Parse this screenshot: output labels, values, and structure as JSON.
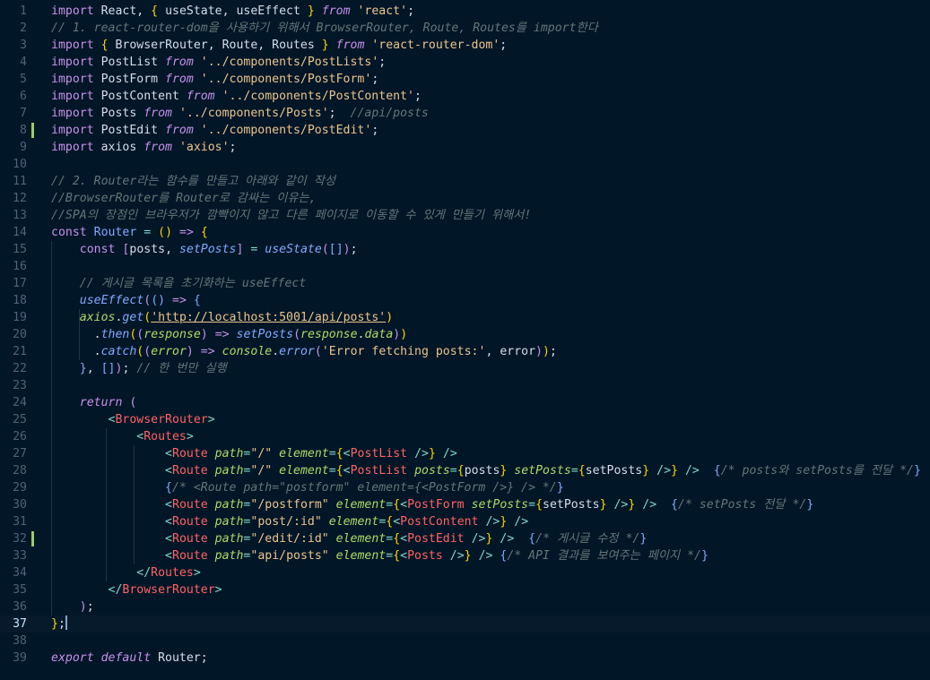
{
  "editor": {
    "language": "javascript-react",
    "theme_colors": {
      "background": "#011627",
      "keyword": "#c792ea",
      "function": "#82aaff",
      "string": "#ecc48d",
      "comment": "#637777",
      "variable": "#addb67",
      "tag": "#ff6363",
      "operator": "#7fdbca",
      "text": "#d6deeb",
      "modified_marker": "#9ccc65"
    },
    "current_line": 37,
    "modified_lines": [
      8,
      32
    ],
    "lines": [
      [
        [
          "kw2",
          "import"
        ],
        [
          "id",
          " React, "
        ],
        [
          "cb",
          "{"
        ],
        [
          "id",
          " useState, useEffect "
        ],
        [
          "cb",
          "}"
        ],
        [
          "id",
          " "
        ],
        [
          "kw",
          "from"
        ],
        [
          "id",
          " "
        ],
        [
          "str",
          "'react'"
        ],
        [
          "id",
          ";"
        ]
      ],
      [
        [
          "cm",
          "// 1. react-router-dom을 사용하기 위해서 BrowserRouter, Route, Routes를 import한다"
        ]
      ],
      [
        [
          "kw2",
          "import"
        ],
        [
          "id",
          " "
        ],
        [
          "cb",
          "{"
        ],
        [
          "id",
          " BrowserRouter, Route, Routes "
        ],
        [
          "cb",
          "}"
        ],
        [
          "id",
          " "
        ],
        [
          "kw",
          "from"
        ],
        [
          "id",
          " "
        ],
        [
          "str",
          "'react-router-dom'"
        ],
        [
          "id",
          ";"
        ]
      ],
      [
        [
          "kw2",
          "import"
        ],
        [
          "id",
          " PostList "
        ],
        [
          "kw",
          "from"
        ],
        [
          "id",
          " "
        ],
        [
          "str",
          "'../components/PostLists'"
        ],
        [
          "id",
          ";"
        ]
      ],
      [
        [
          "kw2",
          "import"
        ],
        [
          "id",
          " PostForm "
        ],
        [
          "kw",
          "from"
        ],
        [
          "id",
          " "
        ],
        [
          "str",
          "'../components/PostForm'"
        ],
        [
          "id",
          ";"
        ]
      ],
      [
        [
          "kw2",
          "import"
        ],
        [
          "id",
          " PostContent "
        ],
        [
          "kw",
          "from"
        ],
        [
          "id",
          " "
        ],
        [
          "str",
          "'../components/PostContent'"
        ],
        [
          "id",
          ";"
        ]
      ],
      [
        [
          "kw2",
          "import"
        ],
        [
          "id",
          " Posts "
        ],
        [
          "kw",
          "from"
        ],
        [
          "id",
          " "
        ],
        [
          "str",
          "'../components/Posts'"
        ],
        [
          "id",
          ";  "
        ],
        [
          "cm",
          "//api/posts"
        ]
      ],
      [
        [
          "kw2",
          "import"
        ],
        [
          "id",
          " PostEdit "
        ],
        [
          "kw",
          "from"
        ],
        [
          "id",
          " "
        ],
        [
          "str",
          "'../components/PostEdit'"
        ],
        [
          "id",
          ";"
        ]
      ],
      [
        [
          "kw2",
          "import"
        ],
        [
          "id",
          " axios "
        ],
        [
          "kw",
          "from"
        ],
        [
          "id",
          " "
        ],
        [
          "str",
          "'axios'"
        ],
        [
          "id",
          ";"
        ]
      ],
      [],
      [
        [
          "cm",
          "// 2. Router라는 함수를 만들고 아래와 같이 작성"
        ]
      ],
      [
        [
          "cm",
          "//BrowserRouter를 Router로 감싸는 이유는,"
        ]
      ],
      [
        [
          "cm",
          "//SPA의 장점인 브라우저가 깜빡이지 않고 다른 페이지로 이동할 수 있게 만들기 위해서!"
        ]
      ],
      [
        [
          "kw2",
          "const"
        ],
        [
          "id",
          " "
        ],
        [
          "fn2",
          "Router"
        ],
        [
          "id",
          " "
        ],
        [
          "punc",
          "="
        ],
        [
          "id",
          " "
        ],
        [
          "cb",
          "()"
        ],
        [
          "id",
          " "
        ],
        [
          "kw2",
          "=>"
        ],
        [
          "id",
          " "
        ],
        [
          "cb",
          "{"
        ]
      ],
      [
        [
          "id",
          "    "
        ],
        [
          "kw2",
          "const"
        ],
        [
          "id",
          " "
        ],
        [
          "kw2",
          "["
        ],
        [
          "id",
          "posts, "
        ],
        [
          "fn",
          "setPosts"
        ],
        [
          "kw2",
          "]"
        ],
        [
          "id",
          " "
        ],
        [
          "punc",
          "="
        ],
        [
          "id",
          " "
        ],
        [
          "fn",
          "useState"
        ],
        [
          "kw2",
          "("
        ],
        [
          "fn2",
          "[]"
        ],
        [
          "kw2",
          ")"
        ],
        [
          "id",
          ";"
        ]
      ],
      [],
      [
        [
          "id",
          "    "
        ],
        [
          "cm",
          "// 게시글 목록을 초기화하는 useEffect"
        ]
      ],
      [
        [
          "id",
          "    "
        ],
        [
          "fn",
          "useEffect"
        ],
        [
          "kw2",
          "("
        ],
        [
          "fn2",
          "()"
        ],
        [
          "id",
          " "
        ],
        [
          "kw2",
          "=>"
        ],
        [
          "id",
          " "
        ],
        [
          "fn2",
          "{"
        ]
      ],
      [
        [
          "id",
          "    "
        ],
        [
          "var",
          "axios"
        ],
        [
          "id",
          "."
        ],
        [
          "fn",
          "get"
        ],
        [
          "cb",
          "("
        ],
        [
          "url",
          "'http://localhost:5001/api/posts'"
        ],
        [
          "cb",
          ")"
        ]
      ],
      [
        [
          "id",
          "      ."
        ],
        [
          "fn",
          "then"
        ],
        [
          "cb",
          "("
        ],
        [
          "kw2",
          "("
        ],
        [
          "var",
          "response"
        ],
        [
          "kw2",
          ")"
        ],
        [
          "id",
          " "
        ],
        [
          "kw2",
          "=>"
        ],
        [
          "id",
          " "
        ],
        [
          "fn",
          "setPosts"
        ],
        [
          "kw2",
          "("
        ],
        [
          "var",
          "response"
        ],
        [
          "id",
          "."
        ],
        [
          "var",
          "data"
        ],
        [
          "kw2",
          ")"
        ],
        [
          "cb",
          ")"
        ]
      ],
      [
        [
          "id",
          "      ."
        ],
        [
          "fn",
          "catch"
        ],
        [
          "cb",
          "("
        ],
        [
          "kw2",
          "("
        ],
        [
          "var",
          "error"
        ],
        [
          "kw2",
          ")"
        ],
        [
          "id",
          " "
        ],
        [
          "kw2",
          "=>"
        ],
        [
          "id",
          " "
        ],
        [
          "var",
          "console"
        ],
        [
          "id",
          "."
        ],
        [
          "fn",
          "error"
        ],
        [
          "kw2",
          "("
        ],
        [
          "str",
          "'Error fetching posts:'"
        ],
        [
          "id",
          ", error"
        ],
        [
          "kw2",
          ")"
        ],
        [
          "cb",
          ")"
        ],
        [
          "id",
          ";"
        ]
      ],
      [
        [
          "id",
          "    "
        ],
        [
          "fn2",
          "}"
        ],
        [
          "id",
          ", "
        ],
        [
          "fn2",
          "[]"
        ],
        [
          "kw2",
          ")"
        ],
        [
          "id",
          "; "
        ],
        [
          "cm",
          "// 한 번만 실행"
        ]
      ],
      [],
      [
        [
          "id",
          "    "
        ],
        [
          "kw",
          "return"
        ],
        [
          "id",
          " "
        ],
        [
          "kw2",
          "("
        ]
      ],
      [
        [
          "id",
          "        "
        ],
        [
          "punc",
          "<"
        ],
        [
          "tg",
          "BrowserRouter"
        ],
        [
          "punc",
          ">"
        ]
      ],
      [
        [
          "id",
          "            "
        ],
        [
          "punc",
          "<"
        ],
        [
          "tg",
          "Routes"
        ],
        [
          "punc",
          ">"
        ]
      ],
      [
        [
          "id",
          "                "
        ],
        [
          "punc",
          "<"
        ],
        [
          "tg",
          "Route"
        ],
        [
          "id",
          " "
        ],
        [
          "var",
          "path"
        ],
        [
          "punc",
          "="
        ],
        [
          "str",
          "\"/\""
        ],
        [
          "id",
          " "
        ],
        [
          "var",
          "element"
        ],
        [
          "punc",
          "="
        ],
        [
          "cb",
          "{"
        ],
        [
          "punc",
          "<"
        ],
        [
          "tg",
          "PostList"
        ],
        [
          "id",
          " "
        ],
        [
          "punc",
          "/>"
        ],
        [
          "cb",
          "}"
        ],
        [
          "id",
          " "
        ],
        [
          "punc",
          "/>"
        ]
      ],
      [
        [
          "id",
          "                "
        ],
        [
          "punc",
          "<"
        ],
        [
          "tg",
          "Route"
        ],
        [
          "id",
          " "
        ],
        [
          "var",
          "path"
        ],
        [
          "punc",
          "="
        ],
        [
          "str",
          "\"/\""
        ],
        [
          "id",
          " "
        ],
        [
          "var",
          "element"
        ],
        [
          "punc",
          "="
        ],
        [
          "cb",
          "{"
        ],
        [
          "punc",
          "<"
        ],
        [
          "tg",
          "PostList"
        ],
        [
          "id",
          " "
        ],
        [
          "var",
          "posts"
        ],
        [
          "punc",
          "="
        ],
        [
          "cb",
          "{"
        ],
        [
          "id",
          "posts"
        ],
        [
          "cb",
          "}"
        ],
        [
          "id",
          " "
        ],
        [
          "var",
          "setPosts"
        ],
        [
          "punc",
          "="
        ],
        [
          "cb",
          "{"
        ],
        [
          "id",
          "setPosts"
        ],
        [
          "cb",
          "}"
        ],
        [
          "id",
          " "
        ],
        [
          "punc",
          "/>"
        ],
        [
          "cb",
          "}"
        ],
        [
          "id",
          " "
        ],
        [
          "punc",
          "/>"
        ],
        [
          "id",
          "  "
        ],
        [
          "fn2",
          "{"
        ],
        [
          "cm",
          "/* posts와 setPosts를 전달 */"
        ],
        [
          "fn2",
          "}"
        ]
      ],
      [
        [
          "id",
          "                "
        ],
        [
          "fn2",
          "{"
        ],
        [
          "cm",
          "/* <Route path=\"postform\" element={<PostForm />} /> */"
        ],
        [
          "fn2",
          "}"
        ]
      ],
      [
        [
          "id",
          "                "
        ],
        [
          "punc",
          "<"
        ],
        [
          "tg",
          "Route"
        ],
        [
          "id",
          " "
        ],
        [
          "var",
          "path"
        ],
        [
          "punc",
          "="
        ],
        [
          "str",
          "\"/postform\""
        ],
        [
          "id",
          " "
        ],
        [
          "var",
          "element"
        ],
        [
          "punc",
          "="
        ],
        [
          "cb",
          "{"
        ],
        [
          "punc",
          "<"
        ],
        [
          "tg",
          "PostForm"
        ],
        [
          "id",
          " "
        ],
        [
          "var",
          "setPosts"
        ],
        [
          "punc",
          "="
        ],
        [
          "cb",
          "{"
        ],
        [
          "id",
          "setPosts"
        ],
        [
          "cb",
          "}"
        ],
        [
          "id",
          " "
        ],
        [
          "punc",
          "/>"
        ],
        [
          "cb",
          "}"
        ],
        [
          "id",
          " "
        ],
        [
          "punc",
          "/>"
        ],
        [
          "id",
          "  "
        ],
        [
          "fn2",
          "{"
        ],
        [
          "cm",
          "/* setPosts 전달 */"
        ],
        [
          "fn2",
          "}"
        ]
      ],
      [
        [
          "id",
          "                "
        ],
        [
          "punc",
          "<"
        ],
        [
          "tg",
          "Route"
        ],
        [
          "id",
          " "
        ],
        [
          "var",
          "path"
        ],
        [
          "punc",
          "="
        ],
        [
          "str",
          "\"post/:id\""
        ],
        [
          "id",
          " "
        ],
        [
          "var",
          "element"
        ],
        [
          "punc",
          "="
        ],
        [
          "cb",
          "{"
        ],
        [
          "punc",
          "<"
        ],
        [
          "tg",
          "PostContent"
        ],
        [
          "id",
          " "
        ],
        [
          "punc",
          "/>"
        ],
        [
          "cb",
          "}"
        ],
        [
          "id",
          " "
        ],
        [
          "punc",
          "/>"
        ]
      ],
      [
        [
          "id",
          "                "
        ],
        [
          "punc",
          "<"
        ],
        [
          "tg",
          "Route"
        ],
        [
          "id",
          " "
        ],
        [
          "var",
          "path"
        ],
        [
          "punc",
          "="
        ],
        [
          "str",
          "\"/edit/:id\""
        ],
        [
          "id",
          " "
        ],
        [
          "var",
          "element"
        ],
        [
          "punc",
          "="
        ],
        [
          "cb",
          "{"
        ],
        [
          "punc",
          "<"
        ],
        [
          "tg",
          "PostEdit"
        ],
        [
          "id",
          " "
        ],
        [
          "punc",
          "/>"
        ],
        [
          "cb",
          "}"
        ],
        [
          "id",
          " "
        ],
        [
          "punc",
          "/>"
        ],
        [
          "id",
          "  "
        ],
        [
          "fn2",
          "{"
        ],
        [
          "cm",
          "/* 게시글 수정 */"
        ],
        [
          "fn2",
          "}"
        ]
      ],
      [
        [
          "id",
          "                "
        ],
        [
          "punc",
          "<"
        ],
        [
          "tg",
          "Route"
        ],
        [
          "id",
          " "
        ],
        [
          "var",
          "path"
        ],
        [
          "punc",
          "="
        ],
        [
          "str",
          "\"api/posts\""
        ],
        [
          "id",
          " "
        ],
        [
          "var",
          "element"
        ],
        [
          "punc",
          "="
        ],
        [
          "cb",
          "{"
        ],
        [
          "punc",
          "<"
        ],
        [
          "tg",
          "Posts"
        ],
        [
          "id",
          " "
        ],
        [
          "punc",
          "/>"
        ],
        [
          "cb",
          "}"
        ],
        [
          "id",
          " "
        ],
        [
          "punc",
          "/>"
        ],
        [
          "id",
          " "
        ],
        [
          "fn2",
          "{"
        ],
        [
          "cm",
          "/* API 결과를 보여주는 페이지 */"
        ],
        [
          "fn2",
          "}"
        ]
      ],
      [
        [
          "id",
          "            "
        ],
        [
          "punc",
          "</"
        ],
        [
          "tg",
          "Routes"
        ],
        [
          "punc",
          ">"
        ]
      ],
      [
        [
          "id",
          "        "
        ],
        [
          "punc",
          "</"
        ],
        [
          "tg",
          "BrowserRouter"
        ],
        [
          "punc",
          ">"
        ]
      ],
      [
        [
          "id",
          "    "
        ],
        [
          "kw2",
          ")"
        ],
        [
          "id",
          ";"
        ]
      ],
      [
        [
          "cb",
          "}"
        ],
        [
          "id",
          ";"
        ]
      ],
      [],
      [
        [
          "kw",
          "export"
        ],
        [
          "id",
          " "
        ],
        [
          "kw",
          "default"
        ],
        [
          "id",
          " Router;"
        ]
      ]
    ]
  }
}
